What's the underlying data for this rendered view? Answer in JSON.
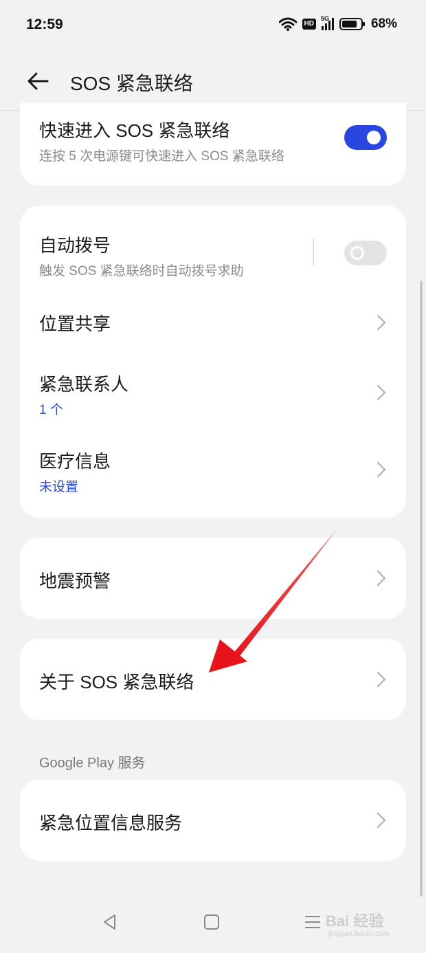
{
  "status": {
    "time": "12:59",
    "hd": "HD",
    "network": "5G",
    "battery": "68%"
  },
  "header": {
    "title": "SOS 紧急联络"
  },
  "quick_entry": {
    "title": "快速进入 SOS 紧急联络",
    "subtitle": "连按 5 次电源键可快速进入 SOS 紧急联络",
    "enabled": true
  },
  "settings": {
    "auto_dial": {
      "title": "自动拨号",
      "subtitle": "触发 SOS 紧急联络时自动拨号求助",
      "enabled": false
    },
    "location_sharing": {
      "title": "位置共享"
    },
    "emergency_contacts": {
      "title": "紧急联系人",
      "subtitle": "1 个"
    },
    "medical_info": {
      "title": "医疗信息",
      "subtitle": "未设置"
    }
  },
  "earthquake": {
    "title": "地震预警"
  },
  "about": {
    "title": "关于 SOS 紧急联络"
  },
  "google_section": {
    "label": "Google Play 服务",
    "emergency_location": {
      "title": "紧急位置信息服务"
    }
  },
  "watermark": {
    "brand": "Bai 经验",
    "url": "jingyan.baidu.com"
  },
  "colors": {
    "accent": "#2a46e0",
    "link_blue": "#2f4ad6",
    "annotation_red": "#e8141c"
  }
}
